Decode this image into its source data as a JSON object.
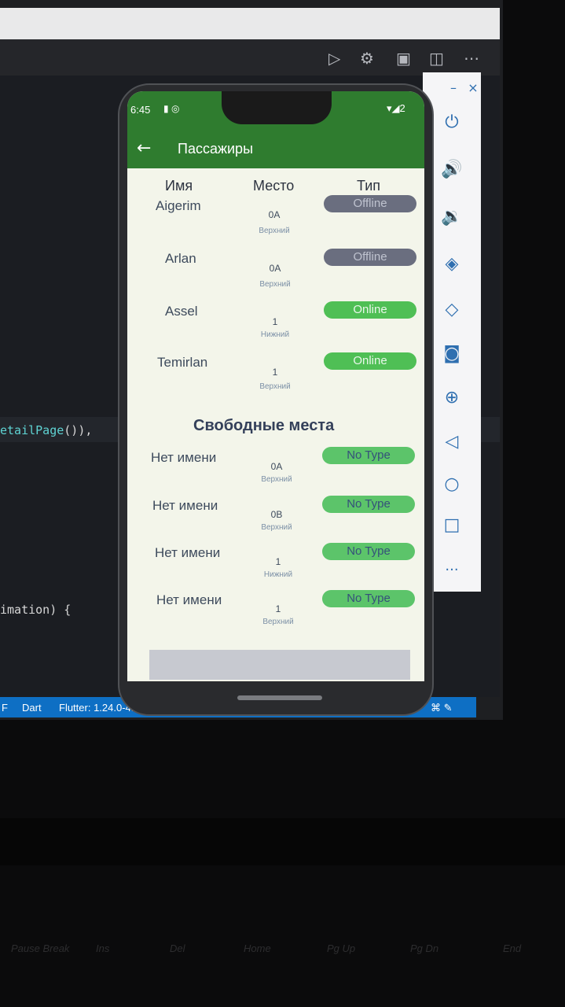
{
  "editor": {
    "code_line_1_prefix": "etailPage",
    "code_line_1_suffix": "()),",
    "code_line_2": "imation) {"
  },
  "statusbar": {
    "left_char": "F",
    "language": "Dart",
    "flutter_version": "Flutter: 1.24.0-4.",
    "right_icons": "⌘ ✎"
  },
  "emulator_panel": {
    "minimize": "–",
    "close": "×",
    "more": "..."
  },
  "android_status": {
    "time": "6:45",
    "right": "▾◢2"
  },
  "app": {
    "title": "Пассажиры",
    "headers": {
      "name": "Имя",
      "seat": "Место",
      "type": "Тип"
    },
    "passengers": [
      {
        "name": "Aigerim",
        "seat": "0A",
        "deck": "Верхний",
        "status": "Offline"
      },
      {
        "name": "Arlan",
        "seat": "0A",
        "deck": "Верхний",
        "status": "Offline"
      },
      {
        "name": "Assel",
        "seat": "1",
        "deck": "Нижний",
        "status": "Online"
      },
      {
        "name": "Temirlan",
        "seat": "1",
        "deck": "Верхний",
        "status": "Online"
      }
    ],
    "free_title": "Свободные места",
    "free_seats": [
      {
        "name": "Нет имени",
        "seat": "0A",
        "deck": "Верхний",
        "type": "No Type"
      },
      {
        "name": "Нет имени",
        "seat": "0B",
        "deck": "Верхний",
        "type": "No Type"
      },
      {
        "name": "Нет имени",
        "seat": "1",
        "deck": "Нижний",
        "type": "No Type"
      },
      {
        "name": "Нет имени",
        "seat": "1",
        "deck": "Верхний",
        "type": "No Type"
      }
    ]
  },
  "keyboard": {
    "keys": [
      "Pause Break",
      "Ins",
      "Del",
      "Home",
      "Pg Up",
      "Pg Dn",
      "End"
    ]
  },
  "colors": {
    "appbar": "#2f7c2f",
    "offline": "#6a6e7f",
    "online": "#4fbf55",
    "statusbar": "#0e6fc4"
  }
}
